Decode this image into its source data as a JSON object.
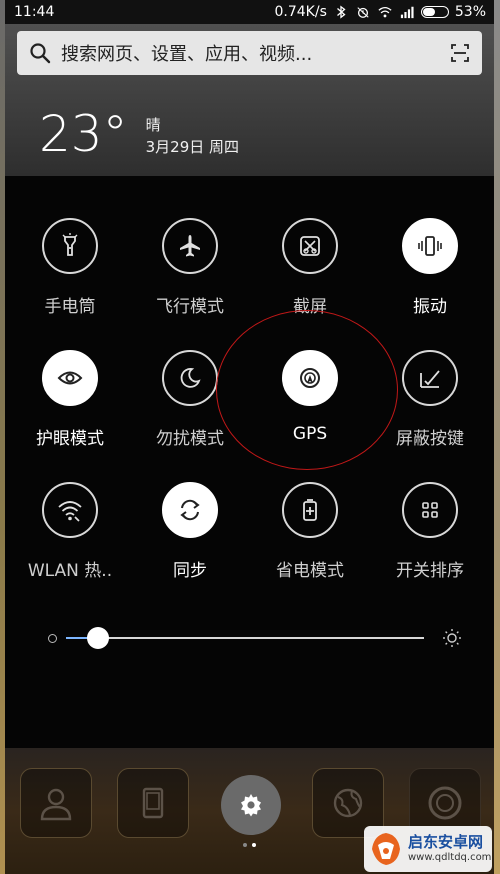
{
  "status_bar": {
    "time": "11:44",
    "net_speed": "0.74K/s",
    "battery_percent": "53%",
    "battery_level": 0.53,
    "icons": [
      "bluetooth-icon",
      "alarm-icon",
      "wifi-icon",
      "signal-icon",
      "battery-icon"
    ]
  },
  "search": {
    "placeholder": "搜索网页、设置、应用、视频...",
    "icons": [
      "search-icon",
      "scan-icon"
    ]
  },
  "weather": {
    "temperature": "23°",
    "condition": "晴",
    "date": "3月29日 周四"
  },
  "toggles": [
    {
      "label": "手电筒",
      "icon": "flashlight-icon",
      "on": false
    },
    {
      "label": "飞行模式",
      "icon": "airplane-icon",
      "on": false
    },
    {
      "label": "截屏",
      "icon": "screenshot-icon",
      "on": false
    },
    {
      "label": "振动",
      "icon": "vibrate-icon",
      "on": true
    },
    {
      "label": "护眼模式",
      "icon": "eye-icon",
      "on": true
    },
    {
      "label": "勿扰模式",
      "icon": "moon-icon",
      "on": false
    },
    {
      "label": "GPS",
      "icon": "gps-icon",
      "on": true
    },
    {
      "label": "屏蔽按键",
      "icon": "block-keys-icon",
      "on": false
    },
    {
      "label": "WLAN 热..",
      "icon": "hotspot-icon",
      "on": false
    },
    {
      "label": "同步",
      "icon": "sync-icon",
      "on": true
    },
    {
      "label": "省电模式",
      "icon": "battery-saver-icon",
      "on": false
    },
    {
      "label": "开关排序",
      "icon": "grid-icon",
      "on": false
    }
  ],
  "brightness": {
    "level": 0.09,
    "icons": [
      "brightness-low-icon",
      "brightness-high-icon"
    ]
  },
  "dock": {
    "icons": [
      "contacts-icon",
      "phone-icon",
      "settings-icon",
      "browser-icon",
      "camera-icon"
    ],
    "page_count": 2,
    "active_page": 2
  },
  "watermark": {
    "title": "启东安卓网",
    "url": "www.qdltdq.com"
  },
  "colors": {
    "accent": "#7db6ff",
    "annotation_circle": "#c01818",
    "panel_bg": "#050505",
    "search_bg": "#e6e6e6"
  }
}
